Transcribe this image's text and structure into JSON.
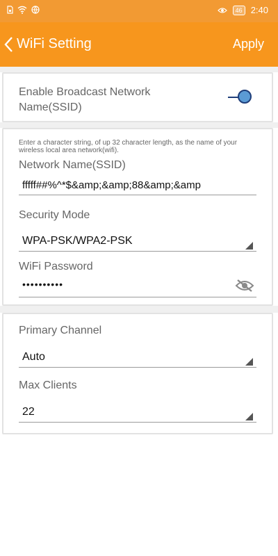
{
  "status_bar": {
    "battery": "46",
    "time": "2:40"
  },
  "header": {
    "title": "WiFi Setting",
    "apply_label": "Apply"
  },
  "broadcast": {
    "label": "Enable Broadcast Network Name(SSID)",
    "enabled": true
  },
  "ssid": {
    "help": "Enter a character string, of up 32 character length, as the name of your wireless local area network(wifi).",
    "label": "Network Name(SSID)",
    "value": "fffff##%^*$&amp;&amp;88&amp;&amp"
  },
  "security": {
    "label": "Security Mode",
    "value": "WPA-PSK/WPA2-PSK"
  },
  "password": {
    "label": "WiFi Password",
    "value": "••••••••••",
    "toggle_icon": "eye-off-icon"
  },
  "channel": {
    "label": "Primary Channel",
    "value": "Auto"
  },
  "max_clients": {
    "label": "Max Clients",
    "value": "22"
  },
  "colors": {
    "status_bar": "#F29A33",
    "app_bar": "#F7961D",
    "toggle_thumb": "#5B9BD5",
    "toggle_track": "#1F3E7A"
  }
}
